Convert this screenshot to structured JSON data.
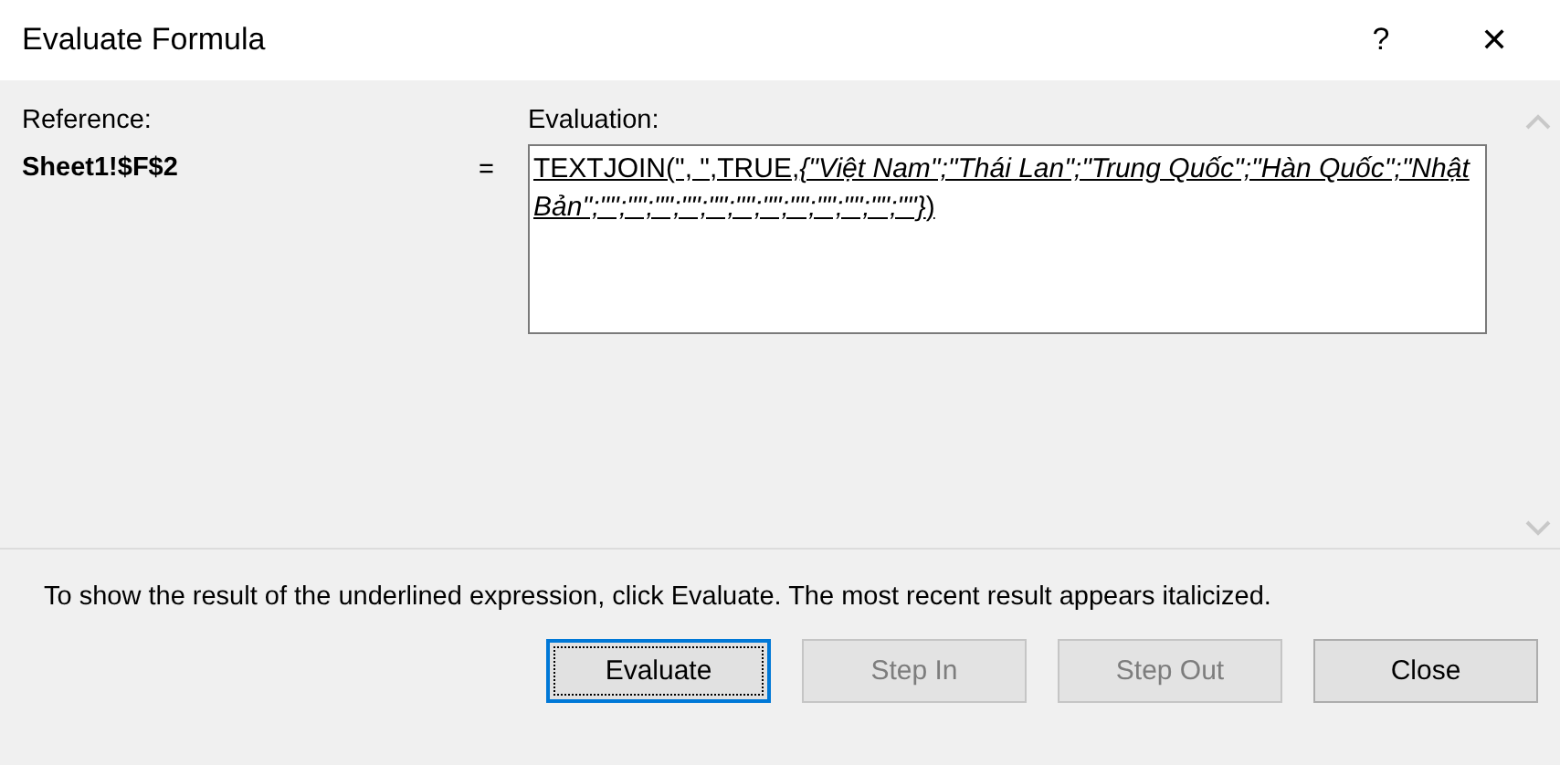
{
  "window": {
    "title": "Evaluate Formula",
    "help": "?",
    "close": "✕"
  },
  "reference": {
    "label": "Reference:",
    "value": "Sheet1!$F$2"
  },
  "equals": "=",
  "evaluation": {
    "label": "Evaluation:",
    "value": "TEXTJOIN(\", \",TRUE,*{\"Việt Nam\";\"Thái Lan\";\"Trung Quốc\";\"Hàn Quốc\";\"Nhật Bản\";\"\";\"\";\"\";\"\";\"\";\"\";\"\";\"\";\"\";\"\";\"\";\"\"}*)"
  },
  "note": "To show the result of the underlined expression, click Evaluate.  The most recent result appears italicized.",
  "buttons": [
    {
      "label": "Evaluate",
      "disabled": false,
      "default": true
    },
    {
      "label": "Step In",
      "disabled": true,
      "default": false
    },
    {
      "label": "Step Out",
      "disabled": true,
      "default": false
    },
    {
      "label": "Close",
      "disabled": false,
      "default": false
    }
  ]
}
